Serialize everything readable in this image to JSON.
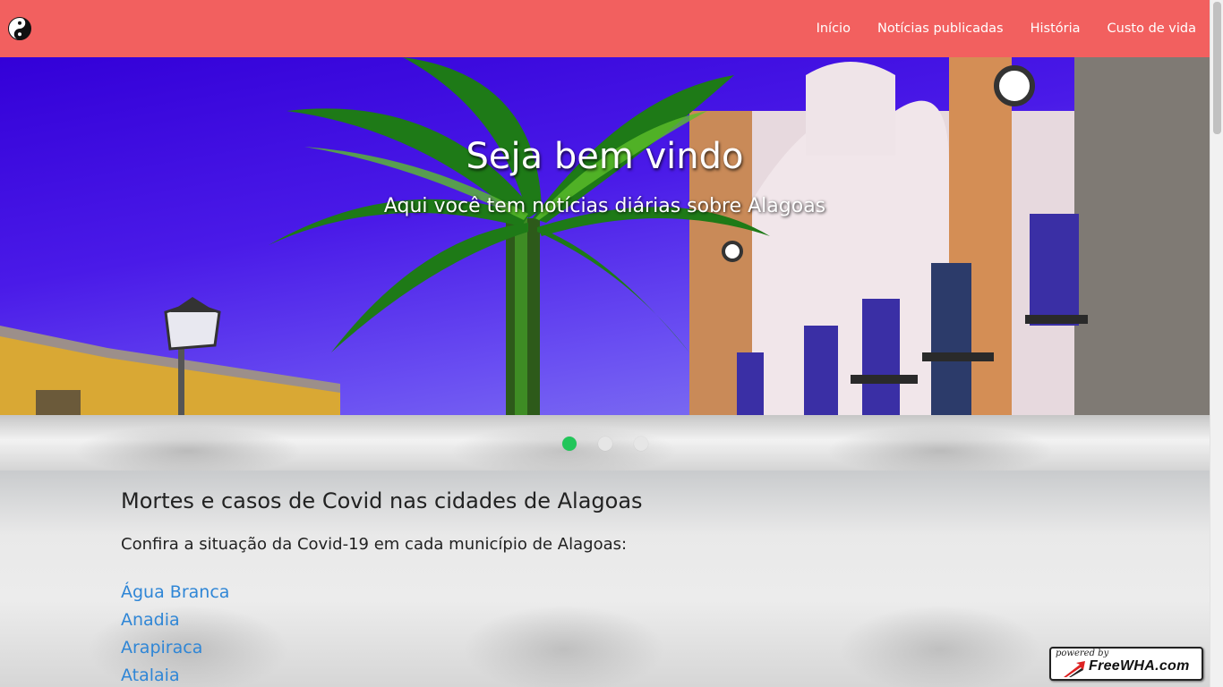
{
  "colors": {
    "navbar_bg": "#f2605f",
    "link": "#2f86d6",
    "indicator_active": "#22c65a",
    "indicator_inactive": "#e6e6e6"
  },
  "navbar": {
    "brand_icon": "yin-yang-icon",
    "links": [
      "Início",
      "Notícias publicadas",
      "História",
      "Custo de vida"
    ]
  },
  "hero": {
    "title": "Seja bem vindo",
    "subtitle": "Aqui você tem notícias diárias sobre Alagoas"
  },
  "carousel": {
    "slides": 3,
    "active_index": 0
  },
  "content": {
    "title": "Mortes e casos de Covid nas cidades de Alagoas",
    "lead": "Confira a situação da Covid-19 em cada município de Alagoas:",
    "cities": [
      "Água Branca",
      "Anadia",
      "Arapiraca",
      "Atalaia"
    ]
  },
  "badge": {
    "powered": "powered by",
    "brand": "FreeWHA.com"
  }
}
